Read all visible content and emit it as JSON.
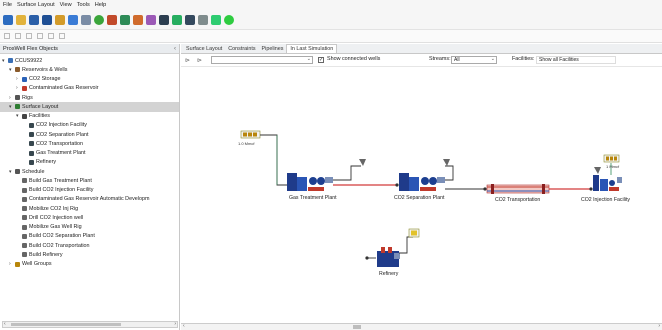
{
  "menu": [
    "File",
    "Surface Layout",
    "View",
    "Tools",
    "Help"
  ],
  "toolbar": {
    "icons": [
      "new-icon",
      "open-icon",
      "save-icon",
      "run-icon",
      "info-icon",
      "tools-icon",
      "report-icon",
      "green-circle-icon",
      "well-icon",
      "globe-icon",
      "link-icon",
      "settings-icon",
      "chart-icon",
      "filter-icon",
      "layout-icon",
      "network-icon",
      "check-icon",
      "green-dot-icon"
    ],
    "colors": [
      "#2d6cc0",
      "#e2b33c",
      "#2b5fa8",
      "#1f4f94",
      "#d39b2a",
      "#3a7bd5",
      "#7a8ca5",
      "#3aa53a",
      "#c24a2a",
      "#2e8b57",
      "#d06b2c",
      "#9b59b6",
      "#2c3e50",
      "#27ae60",
      "#34495e",
      "#7f8c8d",
      "#2ecc71",
      "#2ecc40"
    ]
  },
  "left_panel": {
    "title": "ProsWell Flex Objects",
    "tree": [
      {
        "label": "CCUS9922",
        "level": 0,
        "expand": "▾",
        "icon": "root-icon",
        "color": "#3a6fb5"
      },
      {
        "label": "Reservoirs & Wells",
        "level": 1,
        "expand": "▾",
        "icon": "reservoir-icon",
        "color": "#8a5a2b"
      },
      {
        "label": "CO2 Storage",
        "level": 2,
        "expand": "›",
        "icon": "storage-icon",
        "color": "#2a62b8"
      },
      {
        "label": "Contaminated Gas Reservoir",
        "level": 2,
        "expand": "›",
        "icon": "gas-reservoir-icon",
        "color": "#c0392b"
      },
      {
        "label": "Rigs",
        "level": 1,
        "expand": "›",
        "icon": "rig-icon",
        "color": "#555555"
      },
      {
        "label": "Surface Layout",
        "level": 1,
        "expand": "▾",
        "icon": "layout-icon",
        "color": "#2e7d32"
      },
      {
        "label": "Facilities",
        "level": 2,
        "expand": "▾",
        "icon": "facilities-icon",
        "color": "#444444"
      },
      {
        "label": "CO2 Injection Facility",
        "level": 3,
        "expand": "",
        "icon": "facility-icon",
        "color": "#37474f"
      },
      {
        "label": "CO2 Separation Plant",
        "level": 3,
        "expand": "",
        "icon": "facility-icon",
        "color": "#37474f"
      },
      {
        "label": "CO2 Transportation",
        "level": 3,
        "expand": "",
        "icon": "facility-icon",
        "color": "#37474f"
      },
      {
        "label": "Gas Treatment Plant",
        "level": 3,
        "expand": "",
        "icon": "facility-icon",
        "color": "#37474f"
      },
      {
        "label": "Refinery",
        "level": 3,
        "expand": "",
        "icon": "refinery-icon",
        "color": "#37474f"
      },
      {
        "label": "Schedule",
        "level": 1,
        "expand": "▾",
        "icon": "schedule-icon",
        "color": "#555555"
      },
      {
        "label": "Build Gas Treatment Plant",
        "level": 2,
        "expand": "",
        "icon": "task-icon",
        "color": "#666666"
      },
      {
        "label": "Build CO2 Injection Facility",
        "level": 2,
        "expand": "",
        "icon": "task-icon",
        "color": "#666666"
      },
      {
        "label": "Contaminated Gas Reservoir Automatic Developm",
        "level": 2,
        "expand": "",
        "icon": "task-icon",
        "color": "#666666"
      },
      {
        "label": "Mobilize CO2 Inj Rig",
        "level": 2,
        "expand": "",
        "icon": "task-icon",
        "color": "#666666"
      },
      {
        "label": "Drill CO2 Injection well",
        "level": 2,
        "expand": "",
        "icon": "task-icon",
        "color": "#666666"
      },
      {
        "label": "Mobilize Gas Well Rig",
        "level": 2,
        "expand": "",
        "icon": "task-icon",
        "color": "#666666"
      },
      {
        "label": "Build CO2 Separation Plant",
        "level": 2,
        "expand": "",
        "icon": "task-icon",
        "color": "#666666"
      },
      {
        "label": "Build CO2 Transportation",
        "level": 2,
        "expand": "",
        "icon": "task-icon",
        "color": "#666666"
      },
      {
        "label": "Build Refinery",
        "level": 2,
        "expand": "",
        "icon": "task-icon",
        "color": "#666666"
      },
      {
        "label": "Well Groups",
        "level": 1,
        "expand": "›",
        "icon": "well-groups-icon",
        "color": "#b8860b"
      }
    ],
    "selected_index": 5
  },
  "main": {
    "tabs": [
      "Surface Layout",
      "Constraints",
      "Pipelines",
      "In Last Simulation"
    ],
    "active_tab": 3,
    "filter": {
      "show_connected_label": "Show connected wells",
      "show_connected_checked": true,
      "streams_label": "Streams:",
      "streams_value": "All",
      "facilities_label": "Facilities:",
      "facilities_value": "Show all Facilities"
    },
    "nodes": {
      "gas_treatment": "Gas Treatment Plant",
      "co2_separation": "CO2 Separation Plant",
      "co2_transport": "CO2 Transportation",
      "co2_injection": "CO2 Injection Facility",
      "refinery": "Refinery"
    }
  }
}
